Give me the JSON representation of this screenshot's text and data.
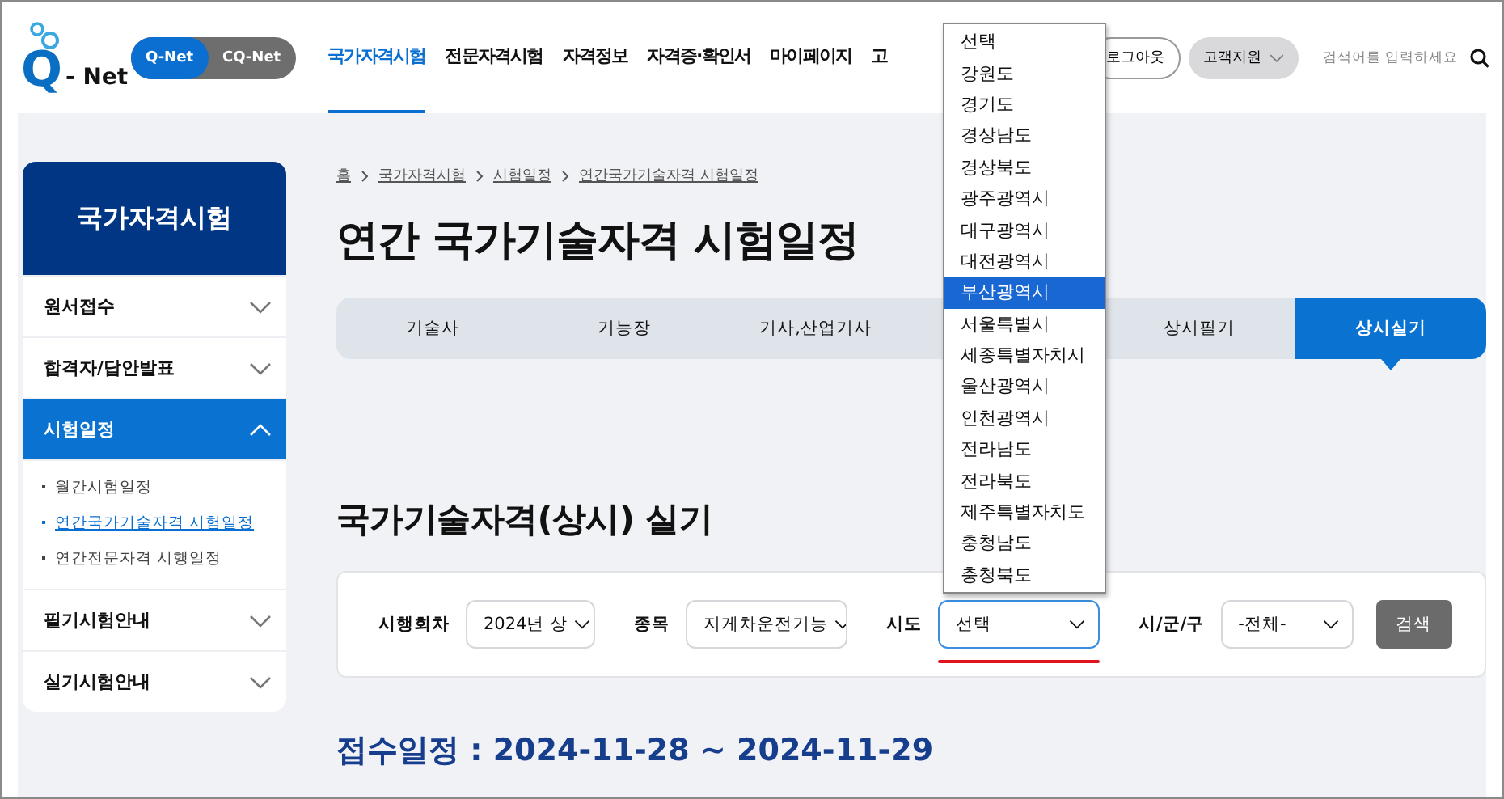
{
  "header": {
    "logo": {
      "mark": "Q",
      "text": "- Net"
    },
    "site_switch": [
      {
        "label": "Q-Net",
        "selected": true
      },
      {
        "label": "CQ-Net",
        "selected": false
      }
    ],
    "nav": [
      {
        "label": "국가자격시험",
        "selected": true
      },
      {
        "label": "전문자격시험",
        "selected": false
      },
      {
        "label": "자격정보",
        "selected": false
      },
      {
        "label": "자격증·확인서",
        "selected": false
      },
      {
        "label": "마이페이지",
        "selected": false
      },
      {
        "label": "고",
        "selected": false
      }
    ],
    "logout_button": "로그아웃",
    "support_button": "고객지원",
    "search": {
      "placeholder": "검색어를 입력하세요"
    }
  },
  "sidebar": {
    "title": "국가자격시험",
    "items": [
      {
        "label": "원서접수",
        "expanded": false
      },
      {
        "label": "합격자/답안발표",
        "expanded": false
      },
      {
        "label": "시험일정",
        "expanded": true,
        "children": [
          {
            "label": "월간시험일정",
            "selected": false
          },
          {
            "label": "연간국가기술자격 시험일정",
            "selected": true
          },
          {
            "label": "연간전문자격 시행일정",
            "selected": false
          }
        ]
      },
      {
        "label": "필기시험안내",
        "expanded": false
      },
      {
        "label": "실기시험안내",
        "expanded": false
      }
    ]
  },
  "breadcrumb": [
    "홈",
    "국가자격시험",
    "시험일정",
    "연간국가기술자격 시험일정"
  ],
  "page_title": "연간 국가기술자격 시험일정",
  "tabs": [
    {
      "kind": "tab",
      "label": "기술사",
      "selected": false
    },
    {
      "kind": "tab",
      "label": "기능장",
      "selected": false
    },
    {
      "kind": "tab",
      "label": "기사,산업기사",
      "selected": false
    },
    {
      "kind": "covered"
    },
    {
      "kind": "tab",
      "label": "상시필기",
      "selected": false
    },
    {
      "kind": "tab",
      "label": "상시실기",
      "selected": true
    }
  ],
  "section_title": "국가기술자격(상시) 실기",
  "filters": [
    {
      "label": "시행회차",
      "value": "2024년 상",
      "focused": false
    },
    {
      "label": "종목",
      "value": "지게차운전기능",
      "focused": false
    },
    {
      "label": "시도",
      "value": "선택",
      "focused": true
    },
    {
      "label": "시/군/구",
      "value": "-전체-",
      "focused": false
    }
  ],
  "search_button": "검색",
  "schedule": "접수일정 : 2024-11-28 ~ 2024-11-29",
  "dropdown": {
    "options": [
      {
        "label": "선택",
        "selected": false
      },
      {
        "label": "강원도",
        "selected": false
      },
      {
        "label": "경기도",
        "selected": false
      },
      {
        "label": "경상남도",
        "selected": false
      },
      {
        "label": "경상북도",
        "selected": false
      },
      {
        "label": "광주광역시",
        "selected": false
      },
      {
        "label": "대구광역시",
        "selected": false
      },
      {
        "label": "대전광역시",
        "selected": false
      },
      {
        "label": "부산광역시",
        "selected": true
      },
      {
        "label": "서울특별시",
        "selected": false
      },
      {
        "label": "세종특별자치시",
        "selected": false
      },
      {
        "label": "울산광역시",
        "selected": false
      },
      {
        "label": "인천광역시",
        "selected": false
      },
      {
        "label": "전라남도",
        "selected": false
      },
      {
        "label": "전라북도",
        "selected": false
      },
      {
        "label": "제주특별자치도",
        "selected": false
      },
      {
        "label": "충청남도",
        "selected": false
      },
      {
        "label": "충청북도",
        "selected": false
      }
    ]
  }
}
